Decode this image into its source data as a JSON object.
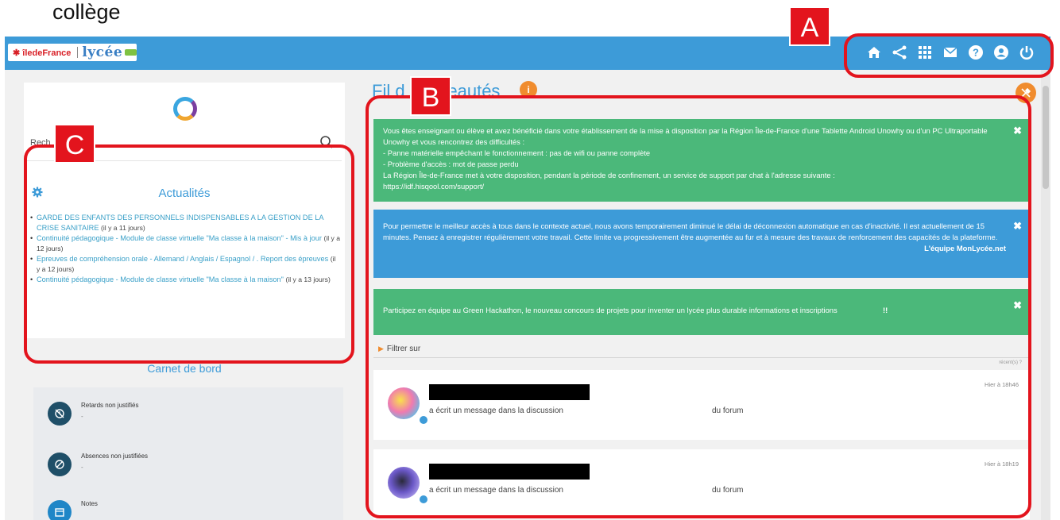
{
  "caption": "collège",
  "topbar": {
    "logo_idf": "✱ îledeFrance",
    "logo_lycee": "lycée",
    "nav_icons": [
      "home-icon",
      "share-icon",
      "apps-grid-icon",
      "mail-icon",
      "help-icon",
      "user-icon",
      "power-icon"
    ]
  },
  "left": {
    "search_placeholder": "Rech",
    "actualites_title": "Actualités",
    "news": [
      {
        "link": "GARDE DES ENFANTS DES PERSONNELS INDISPENSABLES A LA GESTION DE LA CRISE SANITAIRE",
        "date": "(il y a 11 jours)"
      },
      {
        "link": "Continuité pédagogique - Module de classe virtuelle \"Ma classe à la maison\" - Mis à jour",
        "date": "(il y a 12 jours)"
      },
      {
        "link": "Epreuves de compréhension orale - Allemand / Anglais / Espagnol / . Report des épreuves",
        "date": "(il y a 12 jours)"
      },
      {
        "link": "Continuité pédagogique - Module de classe virtuelle \"Ma classe à la maison\"",
        "date": "(il y a 13 jours)"
      }
    ],
    "carnet_title": "Carnet de bord",
    "carnet": [
      {
        "label": "Retards non justifiés",
        "value": "-"
      },
      {
        "label": "Absences non justifiées",
        "value": "-"
      },
      {
        "label": "Notes",
        "value": ""
      }
    ]
  },
  "right": {
    "title": "Fil d nouveautés",
    "badge": "i",
    "alert1": {
      "lines": [
        "Vous êtes enseignant ou élève et avez bénéficié dans votre établissement de la mise à disposition par la Région Île-de-France d'une Tablette Android Unowhy ou d'un PC Ultraportable Unowhy et vous rencontrez des difficultés :",
        "- Panne matérielle empêchant le fonctionnement : pas de wifi ou panne complète",
        "- Problème d'accès : mot de passe perdu",
        "La Région Île-de-France met à votre disposition, pendant la période de confinement, un service de support par chat à l'adresse suivante :",
        "https://idf.hisqool.com/support/"
      ]
    },
    "alert2": {
      "text": "Pour permettre le meilleur accès à tous dans le contexte actuel, nous avons temporairement diminué le délai de déconnexion automatique en cas d'inactivité. Il est actuellement de 15 minutes. Pensez à enregistrer régulièrement votre travail. Cette limite va progressivement être augmentée au fur et à mesure des travaux de renforcement des capacités de la plateforme.",
      "signature": "L'équipe MonLycée.net"
    },
    "alert3": {
      "text": "Participez en équipe au Green Hackathon, le nouveau concours de projets pour inventer un lycée plus durable informations et inscriptions",
      "suffix": "!!"
    },
    "filter_label": "Filtrer sur",
    "recent": "récent(s) ?",
    "posts": [
      {
        "action": "a écrit un message dans la discussion",
        "forum": "du forum",
        "time": "Hier à 18h46"
      },
      {
        "action": "a écrit un message dans la discussion",
        "forum": "du forum",
        "time": "Hier à 18h19"
      }
    ]
  },
  "annotations": {
    "a": "A",
    "b": "B",
    "c": "C"
  },
  "colors": {
    "primary": "#3d9bd8",
    "green": "#4bb87a",
    "orange": "#f08c2e",
    "annotation": "#e3141d"
  }
}
